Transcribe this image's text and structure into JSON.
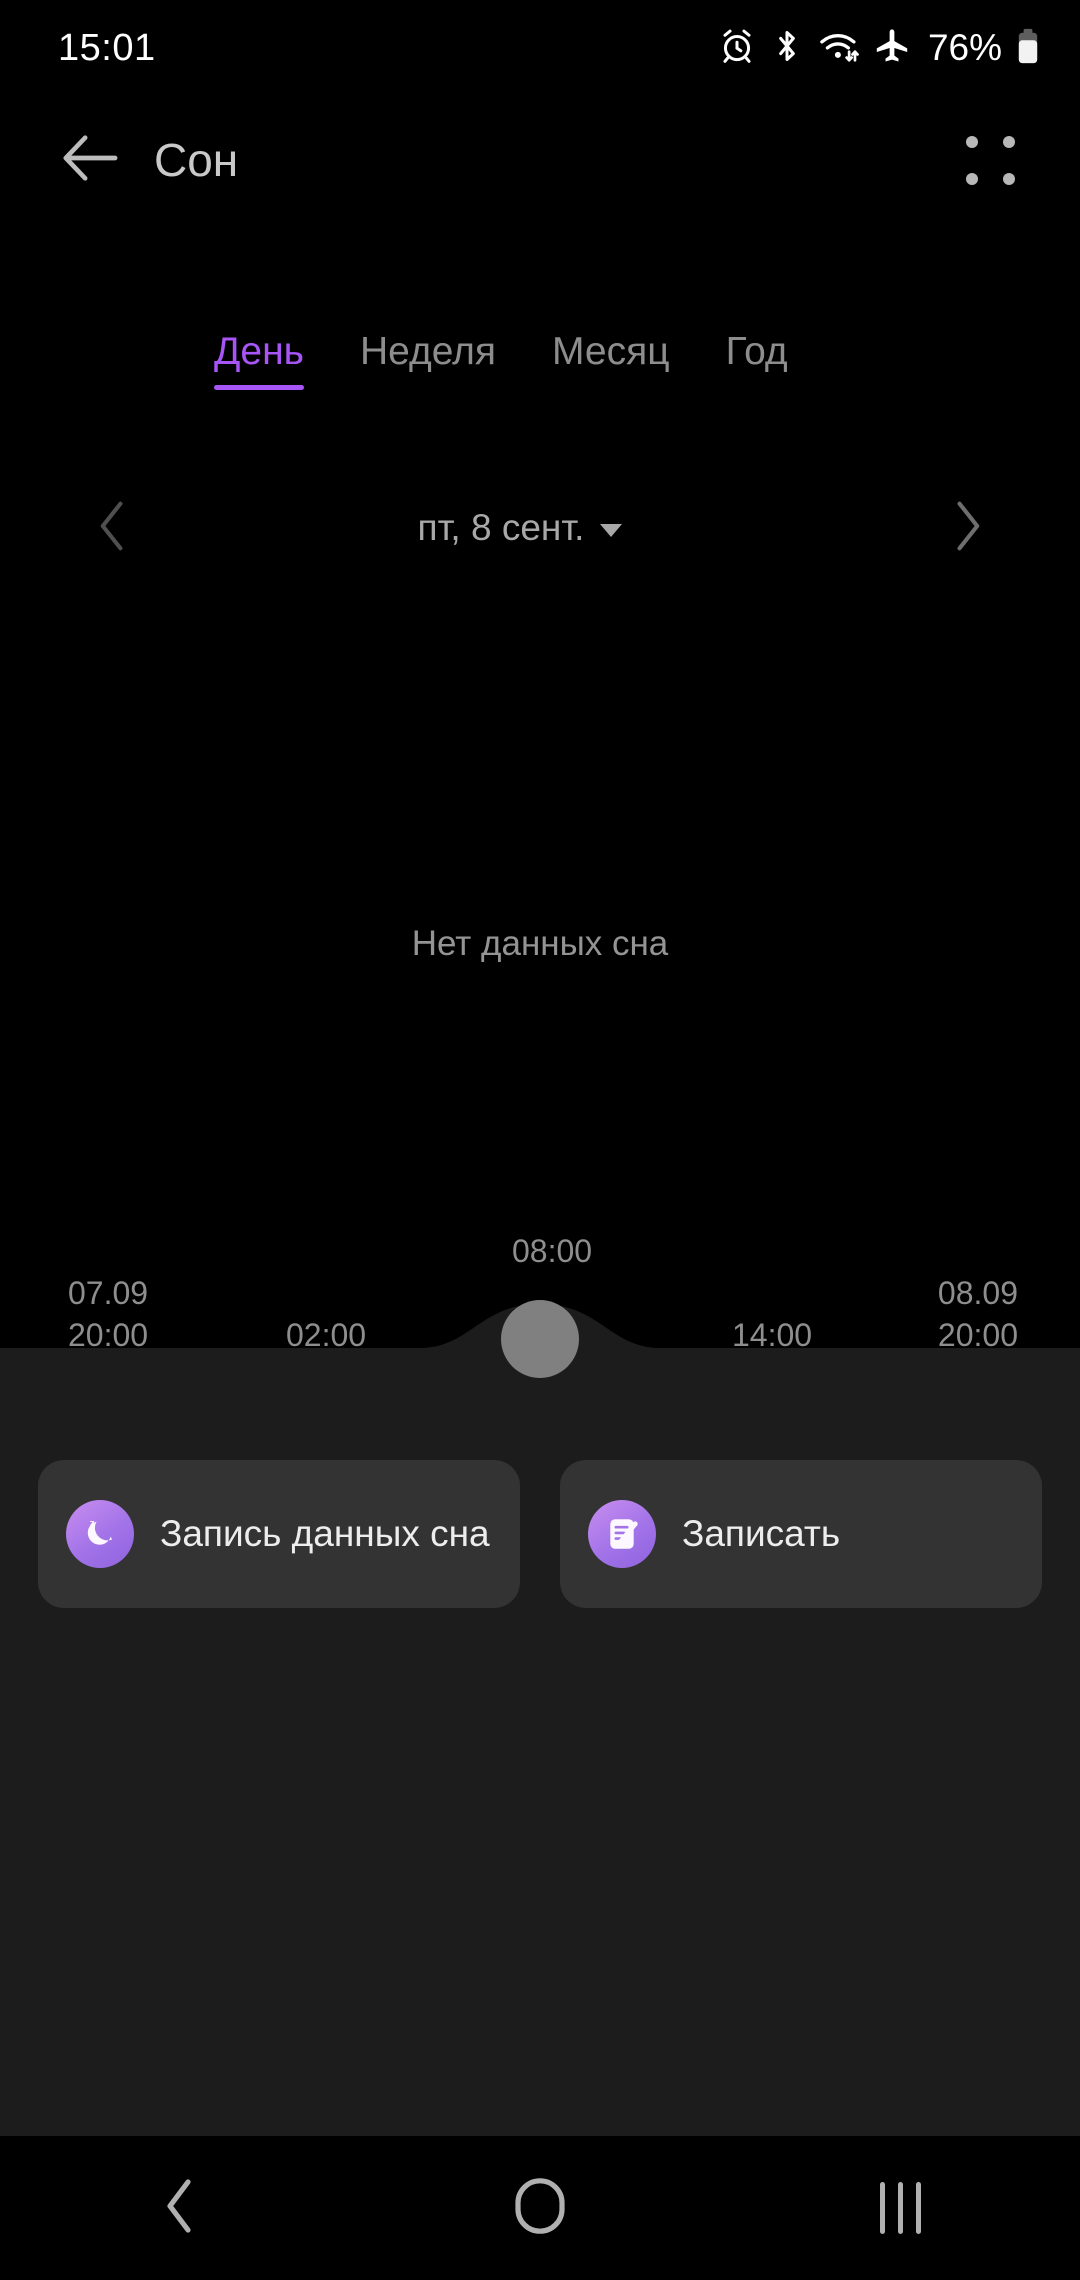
{
  "status_bar": {
    "time": "15:01",
    "battery_percent": "76%",
    "icons": [
      "alarm-icon",
      "bluetooth-icon",
      "wifi-icon",
      "airplane-mode-icon",
      "battery-icon"
    ]
  },
  "app_bar": {
    "title": "Сон",
    "back_icon": "back-arrow-icon",
    "menu_icon": "apps-menu-icon"
  },
  "tabs": {
    "items": [
      {
        "label": "День",
        "active": true
      },
      {
        "label": "Неделя",
        "active": false
      },
      {
        "label": "Месяц",
        "active": false
      },
      {
        "label": "Год",
        "active": false
      }
    ],
    "active_color": "#a855f7",
    "inactive_color": "#8d8d8d"
  },
  "date_nav": {
    "prev_icon": "chevron-left-icon",
    "next_icon": "chevron-right-icon",
    "current": "пт, 8 сент.",
    "dropdown_icon": "caret-down-icon"
  },
  "chart_data": {
    "type": "bar",
    "title": "",
    "empty_state_text": "Нет данных сна",
    "has_data": false,
    "xlabel": "",
    "ylabel": "",
    "series": [],
    "x_axis": {
      "ticks": [
        {
          "date": "07.09",
          "time": "20:00",
          "position": 0
        },
        {
          "date": "",
          "time": "02:00",
          "position": 0.25
        },
        {
          "date": "",
          "time": "08:00",
          "position": 0.5
        },
        {
          "date": "",
          "time": "14:00",
          "position": 0.75
        },
        {
          "date": "08.09",
          "time": "20:00",
          "position": 1
        }
      ],
      "range_start": "07.09 20:00",
      "range_end": "08.09 20:00",
      "grid": false
    },
    "legend": []
  },
  "timeline": {
    "left_date": "07.09",
    "left_time": "20:00",
    "tick_0200": "02:00",
    "tick_0800": "08:00",
    "tick_1400": "14:00",
    "right_date": "08.09",
    "right_time": "20:00",
    "handle_icon": "drag-handle-icon"
  },
  "actions": [
    {
      "label": "Запись данных сна",
      "icon": "sleep-moon-icon"
    },
    {
      "label": "Записать",
      "icon": "note-edit-icon"
    }
  ],
  "nav_bar": {
    "back": "nav-back-icon",
    "home": "nav-home-icon",
    "recents": "nav-recents-icon"
  },
  "colors": {
    "background": "#000000",
    "sheet": "#1c1c1c",
    "card": "#333333",
    "accent": "#a855f7",
    "muted_text": "#8e8e8e",
    "handle": "#808080"
  }
}
